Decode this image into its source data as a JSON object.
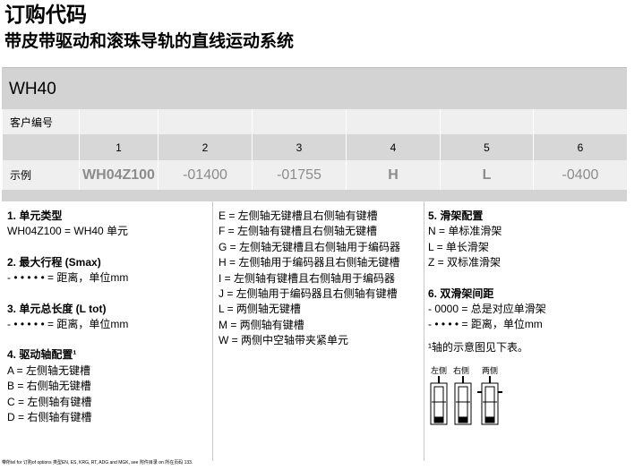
{
  "header": {
    "title": "订购代码",
    "subtitle": "带皮带驱动和滚珠导轨的直线运动系统"
  },
  "model": "WH40",
  "table": {
    "customer_label": "客户编号",
    "columns": [
      "1",
      "2",
      "3",
      "4",
      "5",
      "6"
    ],
    "example_label": "示例",
    "example_values": [
      "WH04Z100",
      "-01400",
      "-01755",
      "H",
      "L",
      "-0400"
    ]
  },
  "col1": {
    "s1_title": "1. 单元类型",
    "s1_line1": "WH04Z100 = WH40 单元",
    "s2_title": "2. 最大行程 (Smax)",
    "s2_line1": "- • • • • • = 距离，单位mm",
    "s3_title": "3. 单元总长度 (L tot)",
    "s3_line1": "- • • • • • = 距离，单位mm",
    "s4_title": "4. 驱动轴配置¹",
    "s4_items": [
      "A = 左侧轴无键槽",
      "B = 右侧轴无键槽",
      "C = 左侧轴有键槽",
      "D = 右侧轴有键槽"
    ]
  },
  "col2": {
    "items": [
      "E = 左侧轴无键槽且右侧轴有键槽",
      "F = 左侧轴有键槽且右侧轴无键槽",
      "G = 左侧轴无键槽且右侧轴用于编码器",
      "H = 左侧轴用于编码器且右侧轴无键槽",
      "I = 左侧轴有键槽且右侧轴用于编码器",
      "J = 左侧轴用于编码器且右侧轴有键槽",
      "L = 两侧轴无键槽",
      "M = 两侧轴有键槽",
      "W = 两侧中空轴带夹紧单元"
    ]
  },
  "col3": {
    "s5_title": "5. 滑架配置",
    "s5_items": [
      "N = 单标准滑架",
      "L = 单长滑架",
      "Z = 双标准滑架"
    ],
    "s6_title": "6. 双滑架间距",
    "s6_items": [
      "- 0000 = 总是对应单滑架",
      "- • • • • = 距离，单位mm"
    ],
    "note": "¹轴的示意图见下表。",
    "icon_labels": [
      "左侧",
      "右侧",
      "两侧"
    ]
  },
  "footer": "带所tel for 订购of options 类型EN, ES, KRG, RT, ADG and MGK, see 附件目录 on 所在页码 133."
}
